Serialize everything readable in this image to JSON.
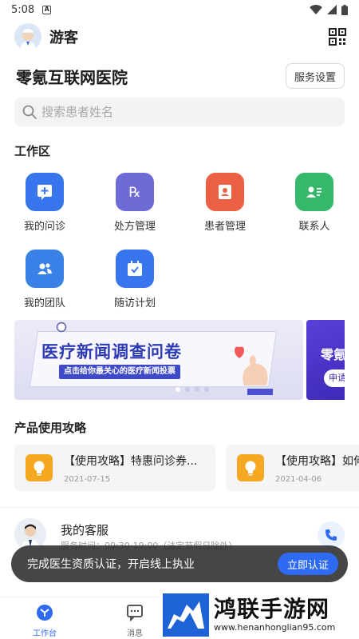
{
  "status_bar": {
    "time": "5:08",
    "a_badge": "A"
  },
  "header": {
    "username": "游客"
  },
  "hospital": {
    "name": "零氪互联网医院",
    "service_settings": "服务设置"
  },
  "search": {
    "placeholder": "搜索患者姓名"
  },
  "workspace": {
    "title": "工作区",
    "items": [
      {
        "label": "我的问诊",
        "color": "#3776ee",
        "icon": "consultation-icon"
      },
      {
        "label": "处方管理",
        "color": "#6f6bd6",
        "icon": "prescription-icon"
      },
      {
        "label": "患者管理",
        "color": "#ec6045",
        "icon": "patient-card-icon"
      },
      {
        "label": "联系人",
        "color": "#35b86a",
        "icon": "contact-icon"
      },
      {
        "label": "我的团队",
        "color": "#3b82e8",
        "icon": "team-icon"
      },
      {
        "label": "随访计划",
        "color": "#3776ee",
        "icon": "calendar-check-icon"
      }
    ]
  },
  "banner": {
    "title": "医疗新闻调查问卷",
    "subtitle": "点击给你最关心的医疗新闻投票",
    "next_title": "零氪",
    "next_button": "申请"
  },
  "guides": {
    "title": "产品使用攻略",
    "items": [
      {
        "title": "【使用攻略】特惠问诊券...",
        "date": "2021-07-15"
      },
      {
        "title": "【使用攻略】如何",
        "date": "2021-04-06"
      }
    ]
  },
  "customer_service": {
    "title": "我的客服",
    "hours": "服务时间：09:30-19:00（法定节假日除外）"
  },
  "toast": {
    "text": "完成医生资质认证，开启线上执业",
    "button": "立即认证"
  },
  "bottom_nav": {
    "items": [
      {
        "label": "工作台",
        "active": true
      },
      {
        "label": "消息",
        "active": false
      }
    ]
  },
  "watermark": {
    "name": "鸿联手游网",
    "url": "www.henanhonglian95.com"
  },
  "colors": {
    "primary": "#2f6bf2",
    "bulb": "#f7a823",
    "banner_blue": "#2e3bb5"
  }
}
